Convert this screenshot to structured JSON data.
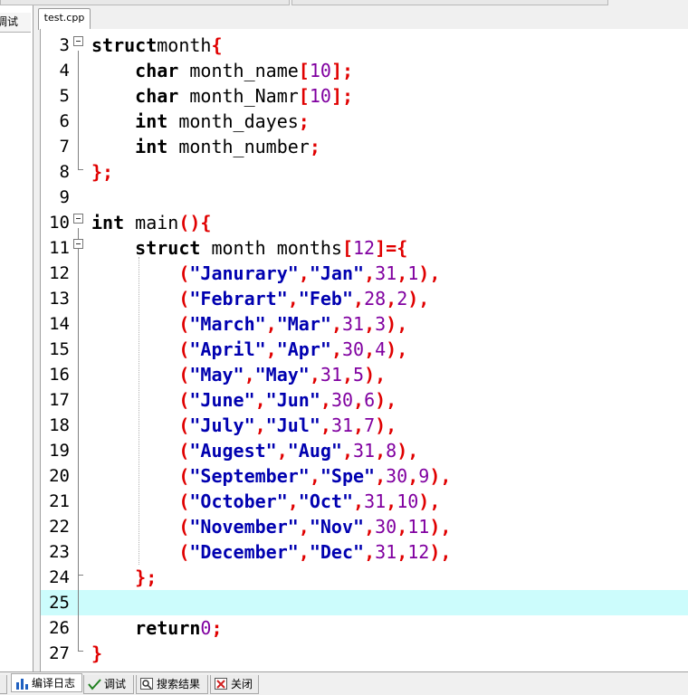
{
  "left_panel": {
    "tab_label": "调试"
  },
  "editor": {
    "file_tab": "test.cpp",
    "current_line": 25,
    "lines": [
      {
        "n": "3",
        "tokens": [
          [
            "kw",
            "struct"
          ],
          [
            "",
            "month"
          ],
          [
            "pn",
            "{"
          ]
        ]
      },
      {
        "n": "4",
        "tokens": [
          [
            "",
            "    "
          ],
          [
            "kw",
            "char"
          ],
          [
            "",
            " month_name"
          ],
          [
            "pn",
            "["
          ],
          [
            "nm",
            "10"
          ],
          [
            "pn",
            "];"
          ]
        ]
      },
      {
        "n": "5",
        "tokens": [
          [
            "",
            "    "
          ],
          [
            "kw",
            "char"
          ],
          [
            "",
            " month_Namr"
          ],
          [
            "pn",
            "["
          ],
          [
            "nm",
            "10"
          ],
          [
            "pn",
            "];"
          ]
        ]
      },
      {
        "n": "6",
        "tokens": [
          [
            "",
            "    "
          ],
          [
            "kw",
            "int"
          ],
          [
            "",
            " month_dayes"
          ],
          [
            "pn",
            ";"
          ]
        ]
      },
      {
        "n": "7",
        "tokens": [
          [
            "",
            "    "
          ],
          [
            "kw",
            "int"
          ],
          [
            "",
            " month_number"
          ],
          [
            "pn",
            ";"
          ]
        ]
      },
      {
        "n": "8",
        "tokens": [
          [
            "pn",
            "};"
          ]
        ]
      },
      {
        "n": "9",
        "tokens": []
      },
      {
        "n": "10",
        "tokens": [
          [
            "kw",
            "int"
          ],
          [
            "",
            " main"
          ],
          [
            "pn",
            "(){"
          ]
        ]
      },
      {
        "n": "11",
        "tokens": [
          [
            "",
            "    "
          ],
          [
            "kw",
            "struct"
          ],
          [
            "",
            " month months"
          ],
          [
            "pn",
            "["
          ],
          [
            "nm",
            "12"
          ],
          [
            "pn",
            "]={"
          ]
        ]
      },
      {
        "n": "12",
        "tokens": [
          [
            "",
            "        "
          ],
          [
            "pn",
            "("
          ],
          [
            "st",
            "\"Janurary\""
          ],
          [
            "pn",
            ","
          ],
          [
            "st",
            "\"Jan\""
          ],
          [
            "pn",
            ","
          ],
          [
            "nm",
            "31"
          ],
          [
            "pn",
            ","
          ],
          [
            "nm",
            "1"
          ],
          [
            "pn",
            "),"
          ]
        ]
      },
      {
        "n": "13",
        "tokens": [
          [
            "",
            "        "
          ],
          [
            "pn",
            "("
          ],
          [
            "st",
            "\"Febrart\""
          ],
          [
            "pn",
            ","
          ],
          [
            "st",
            "\"Feb\""
          ],
          [
            "pn",
            ","
          ],
          [
            "nm",
            "28"
          ],
          [
            "pn",
            ","
          ],
          [
            "nm",
            "2"
          ],
          [
            "pn",
            "),"
          ]
        ]
      },
      {
        "n": "14",
        "tokens": [
          [
            "",
            "        "
          ],
          [
            "pn",
            "("
          ],
          [
            "st",
            "\"March\""
          ],
          [
            "pn",
            ","
          ],
          [
            "st",
            "\"Mar\""
          ],
          [
            "pn",
            ","
          ],
          [
            "nm",
            "31"
          ],
          [
            "pn",
            ","
          ],
          [
            "nm",
            "3"
          ],
          [
            "pn",
            "),"
          ]
        ]
      },
      {
        "n": "15",
        "tokens": [
          [
            "",
            "        "
          ],
          [
            "pn",
            "("
          ],
          [
            "st",
            "\"April\""
          ],
          [
            "pn",
            ","
          ],
          [
            "st",
            "\"Apr\""
          ],
          [
            "pn",
            ","
          ],
          [
            "nm",
            "30"
          ],
          [
            "pn",
            ","
          ],
          [
            "nm",
            "4"
          ],
          [
            "pn",
            "),"
          ]
        ]
      },
      {
        "n": "16",
        "tokens": [
          [
            "",
            "        "
          ],
          [
            "pn",
            "("
          ],
          [
            "st",
            "\"May\""
          ],
          [
            "pn",
            ","
          ],
          [
            "st",
            "\"May\""
          ],
          [
            "pn",
            ","
          ],
          [
            "nm",
            "31"
          ],
          [
            "pn",
            ","
          ],
          [
            "nm",
            "5"
          ],
          [
            "pn",
            "),"
          ]
        ]
      },
      {
        "n": "17",
        "tokens": [
          [
            "",
            "        "
          ],
          [
            "pn",
            "("
          ],
          [
            "st",
            "\"June\""
          ],
          [
            "pn",
            ","
          ],
          [
            "st",
            "\"Jun\""
          ],
          [
            "pn",
            ","
          ],
          [
            "nm",
            "30"
          ],
          [
            "pn",
            ","
          ],
          [
            "nm",
            "6"
          ],
          [
            "pn",
            "),"
          ]
        ]
      },
      {
        "n": "18",
        "tokens": [
          [
            "",
            "        "
          ],
          [
            "pn",
            "("
          ],
          [
            "st",
            "\"July\""
          ],
          [
            "pn",
            ","
          ],
          [
            "st",
            "\"Jul\""
          ],
          [
            "pn",
            ","
          ],
          [
            "nm",
            "31"
          ],
          [
            "pn",
            ","
          ],
          [
            "nm",
            "7"
          ],
          [
            "pn",
            "),"
          ]
        ]
      },
      {
        "n": "19",
        "tokens": [
          [
            "",
            "        "
          ],
          [
            "pn",
            "("
          ],
          [
            "st",
            "\"Augest\""
          ],
          [
            "pn",
            ","
          ],
          [
            "st",
            "\"Aug\""
          ],
          [
            "pn",
            ","
          ],
          [
            "nm",
            "31"
          ],
          [
            "pn",
            ","
          ],
          [
            "nm",
            "8"
          ],
          [
            "pn",
            "),"
          ]
        ]
      },
      {
        "n": "20",
        "tokens": [
          [
            "",
            "        "
          ],
          [
            "pn",
            "("
          ],
          [
            "st",
            "\"September\""
          ],
          [
            "pn",
            ","
          ],
          [
            "st",
            "\"Spe\""
          ],
          [
            "pn",
            ","
          ],
          [
            "nm",
            "30"
          ],
          [
            "pn",
            ","
          ],
          [
            "nm",
            "9"
          ],
          [
            "pn",
            "),"
          ]
        ]
      },
      {
        "n": "21",
        "tokens": [
          [
            "",
            "        "
          ],
          [
            "pn",
            "("
          ],
          [
            "st",
            "\"October\""
          ],
          [
            "pn",
            ","
          ],
          [
            "st",
            "\"Oct\""
          ],
          [
            "pn",
            ","
          ],
          [
            "nm",
            "31"
          ],
          [
            "pn",
            ","
          ],
          [
            "nm",
            "10"
          ],
          [
            "pn",
            "),"
          ]
        ]
      },
      {
        "n": "22",
        "tokens": [
          [
            "",
            "        "
          ],
          [
            "pn",
            "("
          ],
          [
            "st",
            "\"November\""
          ],
          [
            "pn",
            ","
          ],
          [
            "st",
            "\"Nov\""
          ],
          [
            "pn",
            ","
          ],
          [
            "nm",
            "30"
          ],
          [
            "pn",
            ","
          ],
          [
            "nm",
            "11"
          ],
          [
            "pn",
            "),"
          ]
        ]
      },
      {
        "n": "23",
        "tokens": [
          [
            "",
            "        "
          ],
          [
            "pn",
            "("
          ],
          [
            "st",
            "\"December\""
          ],
          [
            "pn",
            ","
          ],
          [
            "st",
            "\"Dec\""
          ],
          [
            "pn",
            ","
          ],
          [
            "nm",
            "31"
          ],
          [
            "pn",
            ","
          ],
          [
            "nm",
            "12"
          ],
          [
            "pn",
            "),"
          ]
        ]
      },
      {
        "n": "24",
        "tokens": [
          [
            "",
            "    "
          ],
          [
            "pn",
            "};"
          ]
        ]
      },
      {
        "n": "25",
        "tokens": []
      },
      {
        "n": "26",
        "tokens": [
          [
            "",
            "    "
          ],
          [
            "kw",
            "return"
          ],
          [
            "",
            "",
            " "
          ],
          [
            "nm",
            "0"
          ],
          [
            "pn",
            ";"
          ]
        ]
      },
      {
        "n": "27",
        "tokens": [
          [
            "pn",
            "}"
          ]
        ]
      }
    ]
  },
  "bottom_tabs": [
    {
      "label": "编译日志",
      "icon": "bar-chart-icon",
      "active": true
    },
    {
      "label": "调试",
      "icon": "checkmark-icon",
      "active": false
    },
    {
      "label": "搜索结果",
      "icon": "search-icon",
      "active": false
    },
    {
      "label": "关闭",
      "icon": "close-icon",
      "active": false
    }
  ],
  "colors": {
    "keyword": "#000000",
    "punctuation": "#e00000",
    "string": "#0000b0",
    "number": "#8000a0",
    "current_line": "#ccfcfc"
  }
}
